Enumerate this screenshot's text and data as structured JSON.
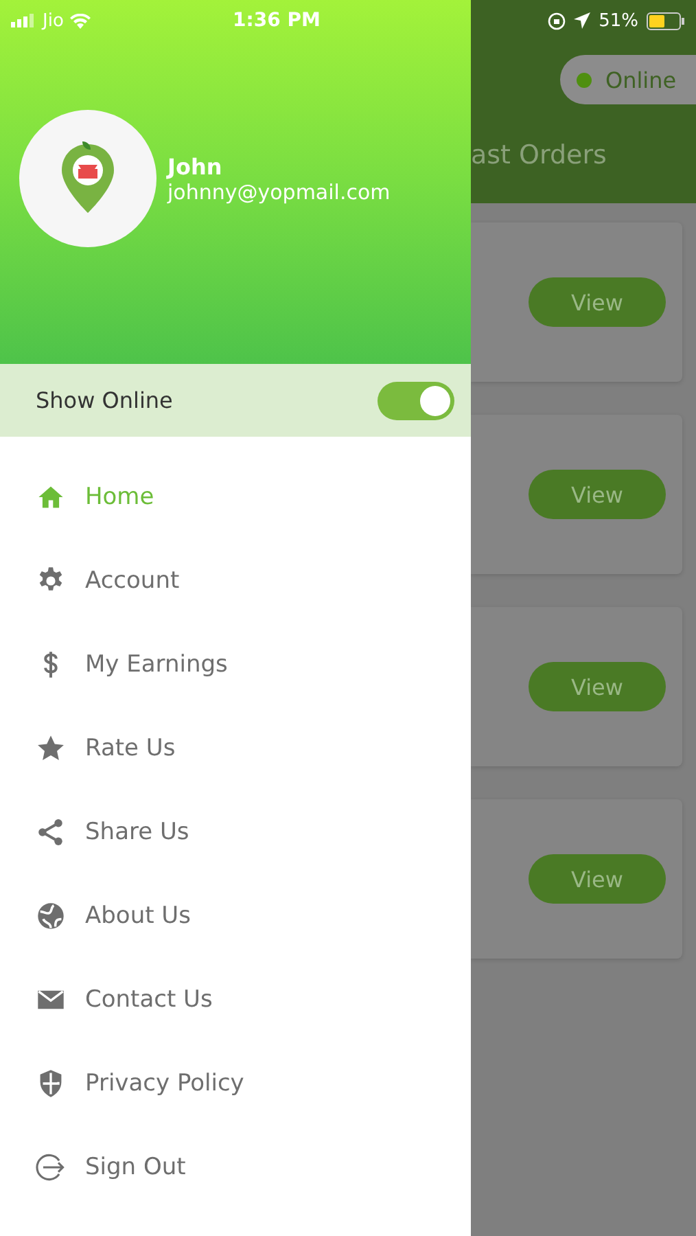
{
  "status_bar": {
    "carrier": "Jio",
    "time": "1:36 PM",
    "battery": "51%"
  },
  "drawer": {
    "user": {
      "name": "John",
      "email": "johnny@yopmail.com"
    },
    "show_online": {
      "label": "Show Online",
      "on": true
    },
    "menu": [
      {
        "label": "Home",
        "selected": true
      },
      {
        "label": "Account",
        "selected": false
      },
      {
        "label": "My Earnings",
        "selected": false
      },
      {
        "label": "Rate Us",
        "selected": false
      },
      {
        "label": "Share Us",
        "selected": false
      },
      {
        "label": "About Us",
        "selected": false
      },
      {
        "label": "Contact Us",
        "selected": false
      },
      {
        "label": "Privacy Policy",
        "selected": false
      },
      {
        "label": "Sign Out",
        "selected": false
      }
    ]
  },
  "background": {
    "status": {
      "label": "Online",
      "color": "#4f8f10"
    },
    "tab": "ast Orders",
    "cards": [
      {
        "button": "View"
      },
      {
        "button": "View"
      },
      {
        "button": "View"
      },
      {
        "button": "View"
      }
    ]
  }
}
